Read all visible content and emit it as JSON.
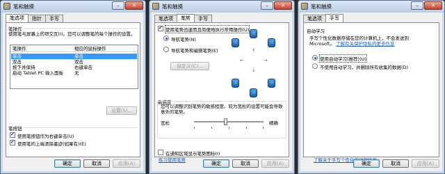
{
  "windows": [
    {
      "title": "笔和触摸",
      "tabs": [
        "笔选项",
        "指针",
        "手写"
      ],
      "active_tab": 0,
      "pen_actions": {
        "group_label": "笔操作",
        "description": "使用笔与屏幕上的项交互(I)。您可以调整笔的每个操作的设置。",
        "columns": [
          "笔操作",
          "相应的鼠标操作"
        ],
        "rows": [
          {
            "action": "单击",
            "mouse": "单击"
          },
          {
            "action": "双击",
            "mouse": "双击"
          },
          {
            "action": "按下并保持",
            "mouse": "右键单击"
          },
          {
            "action": "启动 Tablet PC 输入面板",
            "mouse": "无"
          }
        ],
        "selected_row": 0,
        "settings_button": "设置(S)..."
      },
      "pen_buttons": {
        "group_label": "笔按钮",
        "options": [
          {
            "label": "使用笔按钮作为右键单击(U)",
            "checked": true
          },
          {
            "label": "使用笔的上端清除墨迹(如果有)(E)",
            "checked": true
          }
        ]
      },
      "footer": {
        "ok": "确定",
        "cancel": "取消",
        "apply": "应用(A)"
      }
    },
    {
      "title": "笔和触摸",
      "tabs": [
        "笔选项",
        "笔势",
        "手写"
      ],
      "active_tab": 1,
      "flicks": {
        "enable_label": "使用笔势迅速而且简便地执行常用操作(U)",
        "enable_checked": true,
        "options": [
          {
            "label": "导航笔势(N)",
            "checked": true
          },
          {
            "label": "导航笔势和编辑笔势(E)",
            "checked": false
          }
        ],
        "customize_button": "自定义(C)...",
        "arrows": [
          "↑",
          "↓",
          "←",
          "→"
        ]
      },
      "sensitivity": {
        "group_label": "敏感度",
        "description": "您可以调整识别笔势的敏感程度。较为宽松的设置可能会导致意外的笔势。",
        "left_label": "宽松",
        "right_label": "精确",
        "value_fraction": 0.45
      },
      "notification": {
        "label": "在通知区域显示笔势图标(I)",
        "checked": false
      },
      "practice_link": "练习使用笔势",
      "footer": {
        "ok": "确定",
        "cancel": "取消",
        "apply": "应用(A)"
      }
    },
    {
      "title": "笔和触摸",
      "tabs": [
        "笔选项",
        "手写"
      ],
      "active_tab": 1,
      "autolearn": {
        "group_label": "自动学习",
        "description_1": "手写个性化数据存储在您的计算机上，不会发送到",
        "description_2_prefix": "Microsoft。",
        "description_link": "了解有关保护隐私的更多信息",
        "options": [
          {
            "label": "使用自动学习(推荐)(U)",
            "checked": true
          },
          {
            "label": "不使用自动学习，并删除所有收集的数据(D)",
            "checked": false
          }
        ]
      },
      "bottom_link": "了解关于手写个性化的详细信息",
      "footer": {
        "ok": "确定",
        "cancel": "取消",
        "apply": "应用(A)"
      }
    }
  ]
}
